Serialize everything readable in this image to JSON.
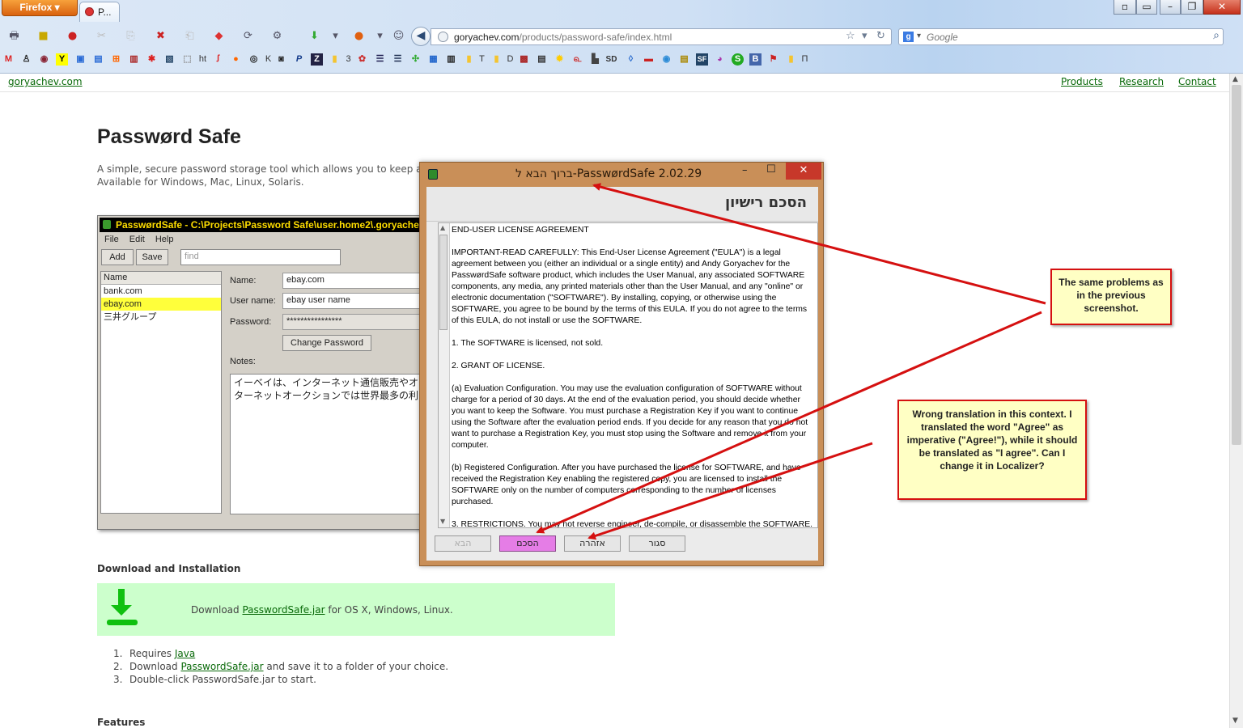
{
  "browser": {
    "app_button": "Firefox",
    "tab_title": "P...",
    "url_host": "goryachev.com",
    "url_path": "/products/password-safe/index.html",
    "search_placeholder": "Google",
    "bookmark_labels": [
      "ht",
      "K",
      "3",
      "T",
      "D",
      "П"
    ]
  },
  "site": {
    "home_link": "goryachev.com",
    "nav": [
      "Products",
      "Research",
      "Contact"
    ]
  },
  "page": {
    "title": "Passwørd Safe",
    "intro_line1": "A simple, secure password storage tool which allows you to keep all your",
    "intro_line2": "Available for Windows, Mac, Linux, Solaris.",
    "download_heading": "Download and Installation",
    "download_prefix": "Download ",
    "download_link": "PasswordSafe.jar",
    "download_suffix": " for OS X, Windows, Linux.",
    "steps": [
      {
        "num": "1.",
        "before": "Requires ",
        "link": "Java",
        "after": ""
      },
      {
        "num": "2.",
        "before": "Download ",
        "link": "PasswordSafe.jar",
        "after": " and save it to a folder of your choice."
      },
      {
        "num": "3.",
        "before": "Double-click PasswordSafe.jar to start.",
        "link": "",
        "after": ""
      }
    ],
    "features_heading": "Features"
  },
  "app_screenshot": {
    "title": "PasswørdSafe - C:\\Projects\\Password Safe\\user.home2\\.goryache",
    "menu": [
      "File",
      "Edit",
      "Help"
    ],
    "add_label": "Add",
    "save_label": "Save",
    "find_placeholder": "find",
    "list_header": "Name",
    "list_items": [
      "bank.com",
      "ebay.com",
      "三井グループ"
    ],
    "name_label": "Name:",
    "name_value": "ebay.com",
    "username_label": "User name:",
    "username_value": "ebay user name",
    "password_label": "Password:",
    "password_value": "****************",
    "change_password_label": "Change Password",
    "notes_label": "Notes:",
    "notes_line1": "イーベイは、インターネット通信販売やオ",
    "notes_line2": "ターネットオークションでは世界最多の利"
  },
  "dialog": {
    "title": "ברוך הבא ל-PasswørdSafe 2.02.29",
    "heading": "הסכם רישיון",
    "eula_paragraphs": [
      "END-USER LICENSE AGREEMENT",
      "IMPORTANT-READ CAREFULLY: This End-User License Agreement (\"EULA\") is a legal agreement between you (either an individual or a single entity) and Andy Goryachev for the PasswørdSafe software product, which includes the User Manual, any associated SOFTWARE components, any media, any printed materials other than the User Manual, and any \"online\" or electronic documentation (\"SOFTWARE\"). By installing, copying, or otherwise using the SOFTWARE, you agree to be bound by the terms of this EULA. If you do not agree to the terms of this EULA, do not install or use the SOFTWARE.",
      "1. The SOFTWARE is licensed, not sold.",
      "2. GRANT OF LICENSE.",
      "(a) Evaluation Configuration. You may use the evaluation configuration of SOFTWARE without charge for a period of 30 days. At the end of the evaluation period, you should decide whether you want to keep the Software. You must purchase a Registration Key if you want to continue using the Software after the evaluation period ends. If you decide for any reason that you do not want to purchase a Registration Key, you must stop using the Software and remove it from your computer.",
      "(b) Registered Configuration. After you have purchased the license for SOFTWARE, and have received the Registration Key enabling the registered copy, you are licensed to install the SOFTWARE only on the number of computers corresponding to the number of licenses purchased.",
      "3. RESTRICTIONS. You may not reverse engineer, de-compile, or disassemble the SOFTWARE."
    ],
    "buttons": {
      "next": "הבא",
      "agree": "הסכם",
      "help": "אזהרה",
      "close": "סגור"
    }
  },
  "callouts": {
    "same_problems": "The same problems as in the previous screenshot.",
    "wrong_translation": "Wrong translation in this context. I translated the word \"Agree\" as imperative (\"Agree!\"), while it should be translated as \"I agree\". Can I change it in Localizer?"
  },
  "colors": {
    "accent_red": "#d51010",
    "callout_bg": "#ffffc4",
    "dialog_frame": "#c98f58",
    "download_bg": "#ccffcc",
    "link_green": "#0a6a0a"
  }
}
